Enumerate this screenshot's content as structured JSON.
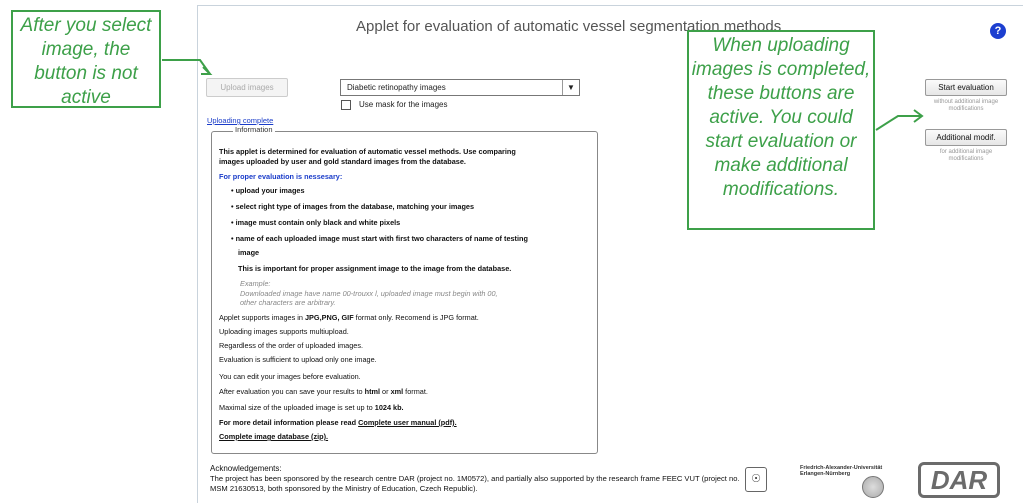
{
  "window": {
    "title": "Applet for evaluation of automatic vessel segmentation methods",
    "help_glyph": "?"
  },
  "controls": {
    "upload_label": "Upload images",
    "image_type_selected": "Diabetic retinopathy images",
    "mask_label": "Use mask for the images",
    "status": "Uploading complete",
    "start_label": "Start evaluation",
    "start_note": "without additional image modifications",
    "modif_label": "Additional modif.",
    "modif_note": "for additional image modifications"
  },
  "information": {
    "legend": "Information",
    "intro_1": "This applet is determined for evaluation of automatic vessel methods. Use comparing",
    "intro_2": "images uploaded by user and gold standard images from the database.",
    "requirements_heading": "For proper evaluation is nessesary:",
    "req_1": "upload your images",
    "req_2": "select right type of images from the database, matching your images",
    "req_3": "image must contain only black and white pixels",
    "req_4a": "name of each uploaded image must start with first two characters of name of testing",
    "req_4b": "image",
    "important": "This is important for proper assignment image to the image from the database.",
    "example_title": "Example:",
    "example_1": "Downloaded image have name 00-trouxx l, uploaded image must begin with 00,",
    "example_2": "other characters are arbitrary.",
    "formats_pre": "Applet supports images in ",
    "formats_bold": "JPG,PNG, GIF",
    "formats_post": " format only. Recomend is JPG format.",
    "line_multi": "Uploading images supports multiupload.",
    "line_order": "Regardless of the order of uploaded images.",
    "line_one": "Evaluation is sufficient to upload only one image.",
    "line_edit": "You can edit your images before evaluation.",
    "save_pre": "After evaluation you can save your results to ",
    "save_html": "html",
    "save_mid": " or ",
    "save_xml": "xml",
    "save_post": " format.",
    "size_pre": "Maximal size of the uploaded image is set up to ",
    "size_value": "1024 kb.",
    "manual_pre": "For more detail information please read ",
    "manual_link": "Complete user manual (pdf).",
    "db_link": "Complete image database (zip)."
  },
  "footer": {
    "ack_title": "Acknowledgements:",
    "ack_text": "The project has been sponsored by the research centre DAR (project no. 1M0572), and partially also supported by the research frame FEEC VUT (project no. MSM 21630513, both sponsored by the Ministry of Education, Czech Republic).",
    "fau_text": "Friedrich-Alexander-Universität Erlangen-Nürnberg",
    "dar_logo": "DAR"
  },
  "annotations": {
    "left": "After you select image, the button is not active",
    "right": "When uploading images is completed, these buttons are active. You could start evaluation or make additional modifications."
  },
  "colors": {
    "callout": "#3da049",
    "link": "#1a3cc9",
    "help": "#1c3fd0"
  }
}
